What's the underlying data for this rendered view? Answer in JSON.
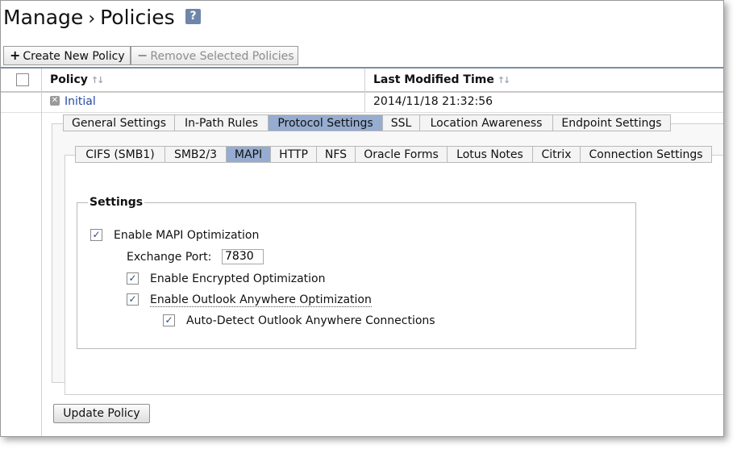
{
  "header": {
    "breadcrumb_root": "Manage",
    "separator": "›",
    "page_title": "Policies",
    "help_label": "?"
  },
  "toolbar": {
    "create_label": "Create New Policy",
    "create_glyph": "+",
    "remove_label": "Remove Selected Policies",
    "remove_glyph": "−"
  },
  "table": {
    "columns": [
      {
        "label": "Policy"
      },
      {
        "label": "Last Modified Time"
      }
    ],
    "rows": [
      {
        "policy": "Initial",
        "modified": "2014/11/18 21:32:56"
      }
    ]
  },
  "policy_tabs": [
    {
      "label": "General Settings",
      "active": false
    },
    {
      "label": "In-Path Rules",
      "active": false
    },
    {
      "label": "Protocol Settings",
      "active": true
    },
    {
      "label": "SSL",
      "active": false
    },
    {
      "label": "Location Awareness",
      "active": false
    },
    {
      "label": "Endpoint Settings",
      "active": false
    }
  ],
  "protocol_tabs": [
    {
      "label": "CIFS (SMB1)",
      "active": false
    },
    {
      "label": "SMB2/3",
      "active": false
    },
    {
      "label": "MAPI",
      "active": true
    },
    {
      "label": "HTTP",
      "active": false
    },
    {
      "label": "NFS",
      "active": false
    },
    {
      "label": "Oracle Forms",
      "active": false
    },
    {
      "label": "Lotus Notes",
      "active": false
    },
    {
      "label": "Citrix",
      "active": false
    },
    {
      "label": "Connection Settings",
      "active": false
    }
  ],
  "settings": {
    "legend": "Settings",
    "enable_mapi": {
      "label": "Enable MAPI Optimization",
      "checked": true
    },
    "exchange_port": {
      "label": "Exchange Port:",
      "value": "7830"
    },
    "enable_encrypted": {
      "label": "Enable Encrypted Optimization",
      "checked": true
    },
    "enable_outlook_anywhere": {
      "label": "Enable Outlook Anywhere Optimization",
      "checked": true
    },
    "auto_detect": {
      "label": "Auto-Detect Outlook Anywhere Connections",
      "checked": true
    }
  },
  "footer": {
    "update_label": "Update Policy"
  },
  "icons": {
    "sort": "sort-arrows-icon",
    "row_close": "close-icon",
    "check": "checkmark-icon"
  },
  "colors": {
    "active_tab": "#96acd0",
    "link": "#274aa5",
    "help": "#6e86a8"
  }
}
